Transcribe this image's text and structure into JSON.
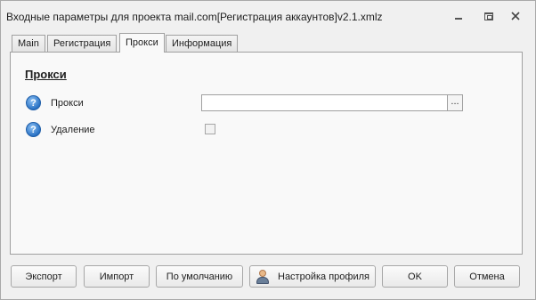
{
  "window": {
    "title": "Входные параметры для проекта mail.com[Регистрация аккаунтов]v2.1.xmlz"
  },
  "tabs": [
    {
      "label": "Main",
      "active": false
    },
    {
      "label": "Регистрация",
      "active": false
    },
    {
      "label": "Прокси",
      "active": true
    },
    {
      "label": "Информация",
      "active": false
    }
  ],
  "panel": {
    "section_title": "Прокси",
    "rows": [
      {
        "label": "Прокси",
        "value": "",
        "icon": "help-icon",
        "control": "text-input"
      },
      {
        "label": "Удаление",
        "checked": false,
        "icon": "help-icon",
        "control": "checkbox"
      }
    ],
    "ellipsis": "...",
    "help_glyph": "?"
  },
  "buttons": {
    "export": "Экспорт",
    "import": "Импорт",
    "defaults": "По умолчанию",
    "profile_settings": "Настройка профиля",
    "ok": "OK",
    "cancel": "Отмена"
  },
  "colors": {
    "window_bg": "#f0f0f0",
    "panel_bg": "#f9f9f9",
    "help_icon": "#2a72c4"
  }
}
